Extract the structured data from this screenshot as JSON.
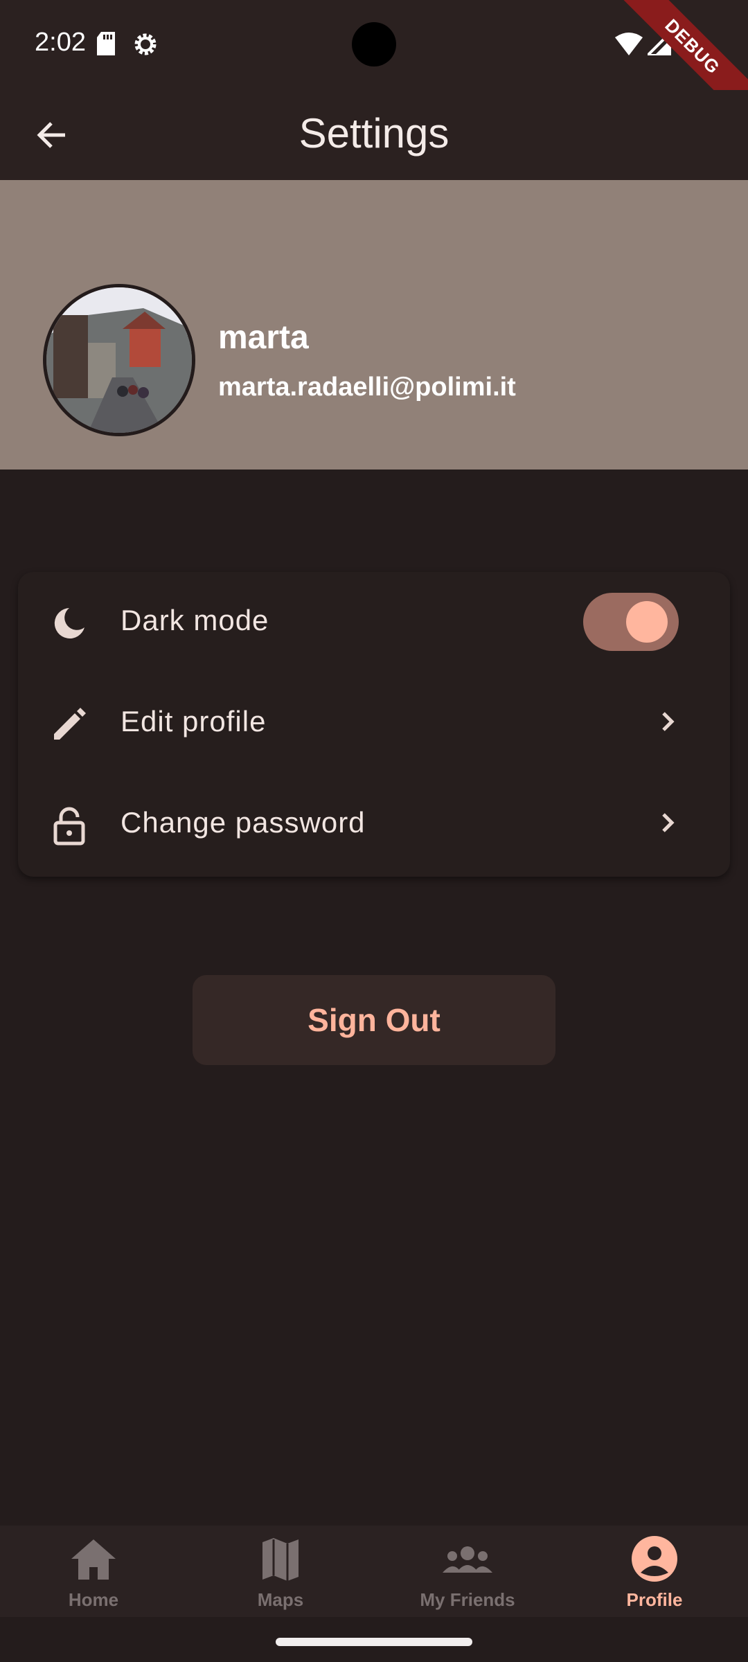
{
  "status_bar": {
    "time": "2:02",
    "debug_label": "DEBUG"
  },
  "app_bar": {
    "title": "Settings"
  },
  "profile": {
    "name": "marta",
    "email": "marta.radaelli@polimi.it"
  },
  "settings": {
    "items": [
      {
        "label": "Dark mode",
        "icon": "moon-icon",
        "control": "toggle",
        "toggled": true
      },
      {
        "label": "Edit profile",
        "icon": "pencil-icon",
        "control": "chevron"
      },
      {
        "label": "Change password",
        "icon": "lock-icon",
        "control": "chevron"
      }
    ]
  },
  "sign_out": {
    "label": "Sign Out"
  },
  "bottom_nav": {
    "items": [
      {
        "label": "Home",
        "icon": "home-icon",
        "active": false
      },
      {
        "label": "Maps",
        "icon": "map-icon",
        "active": false
      },
      {
        "label": "My Friends",
        "icon": "group-icon",
        "active": false
      },
      {
        "label": "Profile",
        "icon": "profile-icon",
        "active": true
      }
    ]
  },
  "colors": {
    "background": "#241c1c",
    "header_bg": "#918178",
    "accent": "#ffb69e",
    "toggle_track": "#9b6b60",
    "inactive_nav": "#7a7070"
  }
}
